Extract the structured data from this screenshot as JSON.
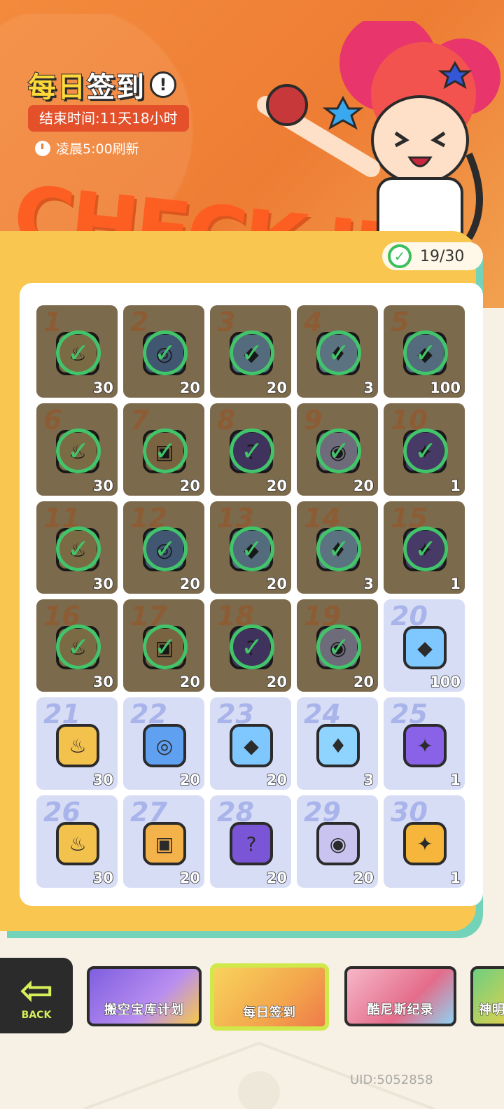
{
  "header": {
    "title_part1": "每日",
    "title_part2": "签到",
    "end_time": "结束时间:11天18小时",
    "refresh_text": "凌晨5:00刷新",
    "bg_word": "CHECK-IN",
    "info_glyph": "!"
  },
  "progress": {
    "text": "19/30",
    "claimed": 19,
    "total": 30
  },
  "rewards": [
    {
      "day": "1",
      "qty": "30",
      "icon": "jar-icon",
      "claimed": true
    },
    {
      "day": "2",
      "qty": "20",
      "icon": "tape-roll-icon",
      "claimed": true
    },
    {
      "day": "3",
      "qty": "20",
      "icon": "gem-icon",
      "claimed": true
    },
    {
      "day": "4",
      "qty": "3",
      "icon": "flame-icon",
      "claimed": true
    },
    {
      "day": "5",
      "qty": "100",
      "icon": "gem-icon",
      "claimed": true
    },
    {
      "day": "6",
      "qty": "30",
      "icon": "jar-icon",
      "claimed": true
    },
    {
      "day": "7",
      "qty": "20",
      "icon": "box-icon",
      "claimed": true
    },
    {
      "day": "8",
      "qty": "20",
      "icon": "mystery-egg-icon",
      "claimed": true
    },
    {
      "day": "9",
      "qty": "20",
      "icon": "can-icon",
      "claimed": true
    },
    {
      "day": "10",
      "qty": "1",
      "icon": "ticket-icon",
      "claimed": true
    },
    {
      "day": "11",
      "qty": "30",
      "icon": "jar-icon",
      "claimed": true
    },
    {
      "day": "12",
      "qty": "20",
      "icon": "tape-roll-icon",
      "claimed": true
    },
    {
      "day": "13",
      "qty": "20",
      "icon": "gem-icon",
      "claimed": true
    },
    {
      "day": "14",
      "qty": "3",
      "icon": "flame-icon",
      "claimed": true
    },
    {
      "day": "15",
      "qty": "1",
      "icon": "ticket-icon",
      "claimed": true
    },
    {
      "day": "16",
      "qty": "30",
      "icon": "jar-icon",
      "claimed": true
    },
    {
      "day": "17",
      "qty": "20",
      "icon": "box-icon",
      "claimed": true
    },
    {
      "day": "18",
      "qty": "20",
      "icon": "mystery-egg-icon",
      "claimed": true
    },
    {
      "day": "19",
      "qty": "20",
      "icon": "can-icon",
      "claimed": true
    },
    {
      "day": "20",
      "qty": "100",
      "icon": "gem-icon",
      "claimed": false
    },
    {
      "day": "21",
      "qty": "30",
      "icon": "jar-icon",
      "claimed": false
    },
    {
      "day": "22",
      "qty": "20",
      "icon": "tape-roll-icon",
      "claimed": false
    },
    {
      "day": "23",
      "qty": "20",
      "icon": "gem-icon",
      "claimed": false
    },
    {
      "day": "24",
      "qty": "3",
      "icon": "flame-icon",
      "claimed": false
    },
    {
      "day": "25",
      "qty": "1",
      "icon": "ticket-icon",
      "claimed": false
    },
    {
      "day": "26",
      "qty": "30",
      "icon": "jar-icon",
      "claimed": false
    },
    {
      "day": "27",
      "qty": "20",
      "icon": "box-icon",
      "claimed": false
    },
    {
      "day": "28",
      "qty": "20",
      "icon": "mystery-egg-icon",
      "claimed": false
    },
    {
      "day": "29",
      "qty": "20",
      "icon": "can-icon",
      "claimed": false
    },
    {
      "day": "30",
      "qty": "1",
      "icon": "gold-ticket-icon",
      "claimed": false
    }
  ],
  "nav": {
    "back_label": "BACK",
    "tabs": [
      {
        "label": "搬空宝库计划"
      },
      {
        "label": "每日签到"
      },
      {
        "label": "酷尼斯纪录"
      },
      {
        "label": "神明"
      }
    ]
  },
  "uid": "UID:5052858",
  "colors": {
    "header_orange": "#ee7d34",
    "panel_yellow": "#f9c74f",
    "claimed_cell": "#7c6a4c",
    "open_cell": "#d8ddf6",
    "check_green": "#42c46a"
  }
}
